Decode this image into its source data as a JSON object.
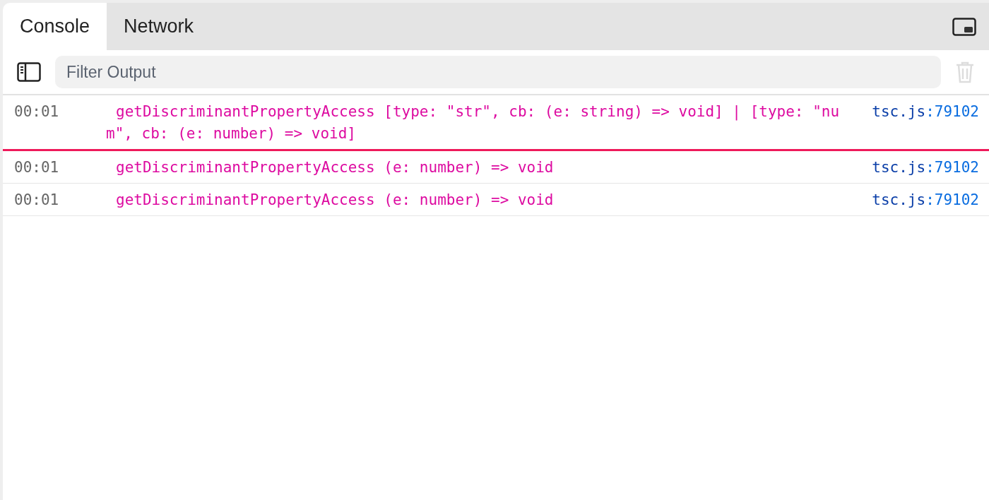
{
  "tabs": [
    {
      "label": "Console",
      "selected": true
    },
    {
      "label": "Network",
      "selected": false
    }
  ],
  "filter": {
    "placeholder": "Filter Output"
  },
  "messages": [
    {
      "time": "00:01",
      "text": "getDiscriminantPropertyAccess [type: \"str\", cb: (e: string) => void] | [type: \"num\", cb: (e: number) => void]",
      "source_file": "tsc.js",
      "source_line": ":79102",
      "marker_below": true
    },
    {
      "time": "00:01",
      "text": "getDiscriminantPropertyAccess (e: number) => void",
      "source_file": "tsc.js",
      "source_line": ":79102",
      "marker_below": false
    },
    {
      "time": "00:01",
      "text": "getDiscriminantPropertyAccess (e: number) => void",
      "source_file": "tsc.js",
      "source_line": ":79102",
      "marker_below": false
    }
  ]
}
